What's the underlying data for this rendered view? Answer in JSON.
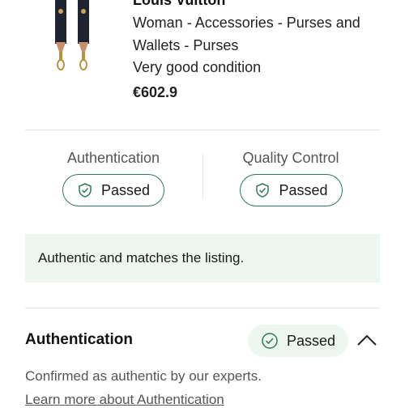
{
  "product": {
    "brand": "Louis Vuitton",
    "category": "Woman - Accessories - Purses and Wallets - Purses",
    "condition": "Very good condition",
    "price": "€602.9"
  },
  "checks": [
    {
      "label": "Authentication",
      "status": "Passed"
    },
    {
      "label": "Quality Control",
      "status": "Passed"
    }
  ],
  "note": "Authentic and matches the listing.",
  "section": {
    "title": "Authentication",
    "status": "Passed",
    "description": "Confirmed as authentic by our experts.",
    "link": "Learn more about Authentication"
  },
  "colors": {
    "accent": "#2f7a55",
    "success_bg": "#eef7ef"
  },
  "icons": [
    "shield-check-icon",
    "check-circle-icon",
    "chevron-up-icon"
  ]
}
